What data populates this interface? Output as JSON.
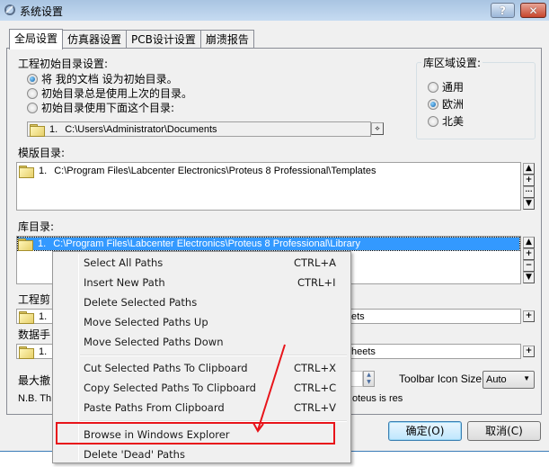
{
  "window": {
    "title": "系统设置",
    "help_label": "?",
    "close_label": "✕"
  },
  "tabs": [
    {
      "label": "全局设置",
      "active": true
    },
    {
      "label": "仿真器设置",
      "active": false
    },
    {
      "label": "PCB设计设置",
      "active": false
    },
    {
      "label": "崩溃报告",
      "active": false
    }
  ],
  "initial_dir": {
    "heading": "工程初始目录设置:",
    "options": [
      {
        "label": "将 我的文档 设为初始目录。",
        "checked": true
      },
      {
        "label": "初始目录总是使用上次的目录。",
        "checked": false
      },
      {
        "label": "初始目录使用下面这个目录:",
        "checked": false
      }
    ],
    "path_index": "1.",
    "path": "C:\\Users\\Administrator\\Documents",
    "browse_icon": "⟡"
  },
  "library_region": {
    "heading": "库区域设置:",
    "options": [
      {
        "label": "通用",
        "checked": false
      },
      {
        "label": "欧洲",
        "checked": true
      },
      {
        "label": "北美",
        "checked": false
      }
    ]
  },
  "template_dir": {
    "heading": "模版目录:",
    "index": "1.",
    "path": "C:\\Program Files\\Labcenter Electronics\\Proteus 8 Professional\\Templates",
    "buttons": [
      "▲",
      "+",
      "···",
      "▼"
    ]
  },
  "library_dir": {
    "heading": "库目录:",
    "index": "1.",
    "path": "C:\\Program Files\\Labcenter Electronics\\Proteus 8 Professional\\Library",
    "buttons": [
      "▲",
      "+",
      "−",
      "▼"
    ]
  },
  "project_clip": {
    "heading_partial": "工程剪",
    "index": "1.",
    "path_tail": "ets",
    "button": "+"
  },
  "datasheet": {
    "heading_partial": "数据手",
    "index": "1.",
    "path_tail": "heets",
    "button": "+"
  },
  "max_undo": {
    "label_partial": "最大撤",
    "spin_up": "▲",
    "spin_down": "▼"
  },
  "toolbar_icon_size": {
    "label": "Toolbar Icon Size:",
    "value": "Auto",
    "arrow": "▼"
  },
  "note": {
    "prefix": "N.B. Th",
    "suffix": "oteus is res"
  },
  "buttons": {
    "ok": "确定(O)",
    "cancel": "取消(C)"
  },
  "context_menu": {
    "items": [
      {
        "label": "Select All Paths",
        "shortcut": "CTRL+A"
      },
      {
        "label": "Insert New Path",
        "shortcut": "CTRL+I"
      },
      {
        "label": "Delete Selected Paths",
        "shortcut": ""
      },
      {
        "label": "Move Selected Paths Up",
        "shortcut": ""
      },
      {
        "label": "Move Selected Paths Down",
        "shortcut": ""
      },
      {
        "label": "Cut Selected Paths To Clipboard",
        "shortcut": "CTRL+X"
      },
      {
        "label": "Copy Selected Paths To Clipboard",
        "shortcut": "CTRL+C"
      },
      {
        "label": "Paste Paths From Clipboard",
        "shortcut": "CTRL+V"
      },
      {
        "label": "Browse in Windows Explorer",
        "shortcut": "",
        "highlighted_by_annotation": true
      },
      {
        "label": "Delete 'Dead' Paths",
        "shortcut": ""
      }
    ]
  },
  "annotation": {
    "color": "#e8141a",
    "target": "Browse in Windows Explorer"
  }
}
